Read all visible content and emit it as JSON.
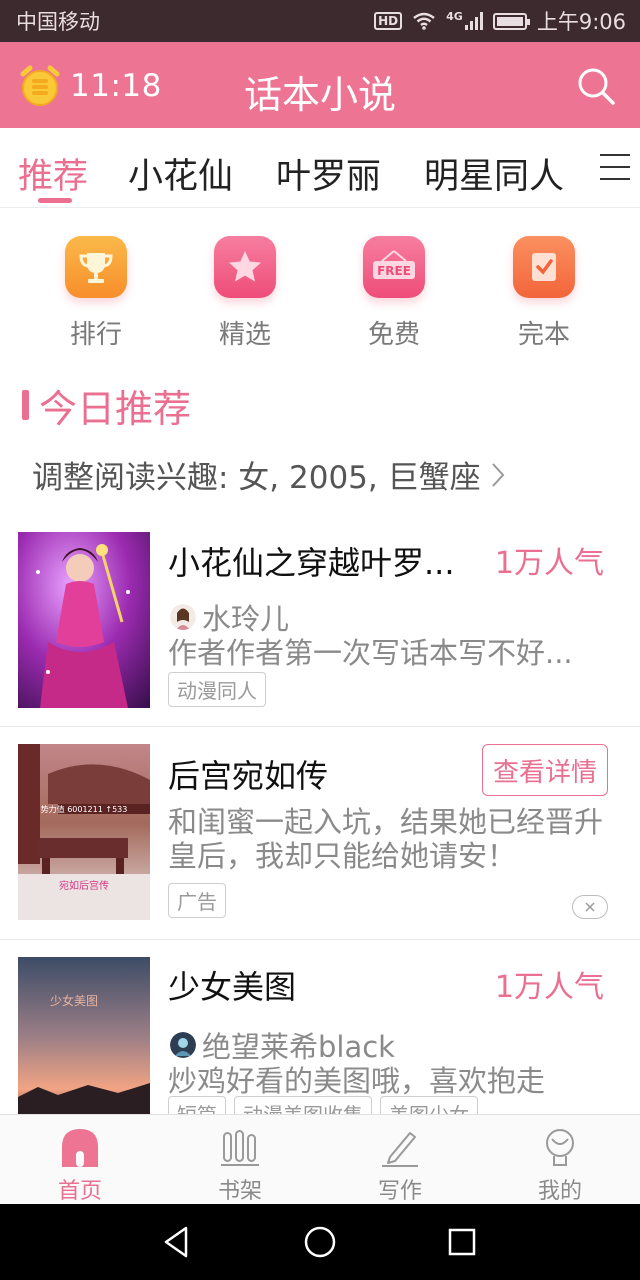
{
  "status_bar": {
    "carrier": "中国移动",
    "hd": "HD",
    "network": "4G",
    "time": "上午9:06"
  },
  "header": {
    "clock_time": "11:18",
    "title": "话本小说",
    "search_icon": "search-icon",
    "clock_icon": "alarm-clock-icon"
  },
  "tabs": [
    {
      "label": "推荐",
      "active": true
    },
    {
      "label": "小花仙",
      "active": false
    },
    {
      "label": "叶罗丽",
      "active": false
    },
    {
      "label": "明星同人",
      "active": false
    }
  ],
  "quick_links": [
    {
      "label": "排行",
      "icon": "trophy-icon",
      "color": "#f7a037"
    },
    {
      "label": "精选",
      "icon": "star-icon",
      "color": "#f05a84"
    },
    {
      "label": "免费",
      "icon": "free-sign-icon",
      "color": "#f05a84",
      "badge": "FREE"
    },
    {
      "label": "完本",
      "icon": "check-book-icon",
      "color": "#f5764a"
    }
  ],
  "section": {
    "title": "今日推荐",
    "interest": "调整阅读兴趣: 女, 2005, 巨蟹座"
  },
  "cards": [
    {
      "title": "小花仙之穿越叶罗...",
      "popularity": "1万人气",
      "author": "水玲儿",
      "description": "作者作者第一次写话本写不好...",
      "tags": [
        "动漫同人"
      ]
    },
    {
      "title": "后宫宛如传",
      "button": "查看详情",
      "description": "和闺蜜一起入坑，结果她已经晋升皇后，我却只能给她请安！",
      "tags": [
        "广告"
      ],
      "cover_text": "势力值 6001211 ↑533",
      "cover_banner": "宛如后宫传"
    },
    {
      "title": "少女美图",
      "popularity": "1万人气",
      "author": "绝望莱希black",
      "description": "炒鸡好看的美图哦，喜欢抱走",
      "tags": [
        "短篇",
        "动漫美图收集",
        "美图少女"
      ],
      "cover_text": "少女美图"
    }
  ],
  "bottom_nav": [
    {
      "label": "首页",
      "icon": "home-icon",
      "active": true
    },
    {
      "label": "书架",
      "icon": "bookshelf-icon",
      "active": false
    },
    {
      "label": "写作",
      "icon": "pencil-icon",
      "active": false
    },
    {
      "label": "我的",
      "icon": "profile-icon",
      "active": false
    }
  ],
  "system_nav": [
    "back-icon",
    "home-circle-icon",
    "recents-icon"
  ],
  "colors": {
    "accent": "#ea6f90",
    "header_bg": "#ee7494",
    "status_bg": "#3d2a2f"
  }
}
